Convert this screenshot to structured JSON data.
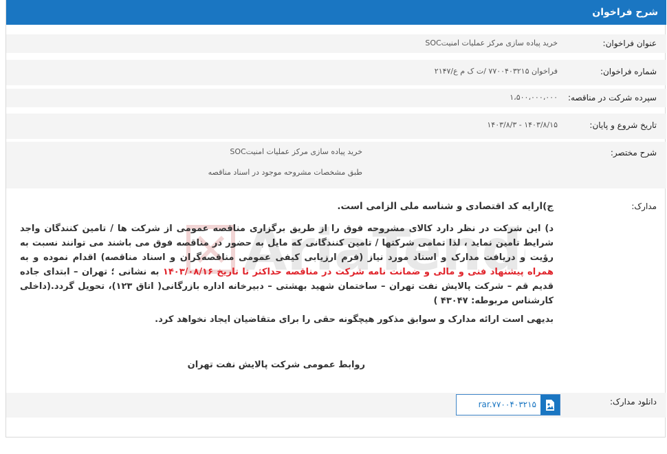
{
  "header": {
    "title": "شرح فراخوان"
  },
  "rows": {
    "title": {
      "label": "عنوان فراخوان:",
      "value": "خرید پیاده سازی مرکز عملیات امنیتSOC"
    },
    "number": {
      "label": "شماره فراخوان:",
      "value": "فراخوان ۷۷۰۰۴۰۳۲۱۵ /ت ک م ع/۲۱۴۷"
    },
    "deposit": {
      "label": "سپرده شرکت در مناقصه:",
      "value": "۱،۵۰۰،۰۰۰،۰۰۰"
    },
    "dates": {
      "label": "تاریخ شروع و پایان:",
      "value": "۱۴۰۳/۸/۱۵ - ۱۴۰۳/۸/۳"
    },
    "summary": {
      "label": "شرح مختصر:",
      "line1": "خرید پیاده سازی مرکز عملیات امنیتSOC",
      "line2": "طبق مشخصات مشروحه موجود در اسناد مناقصه"
    },
    "documents": {
      "label": "مدارک:"
    },
    "download": {
      "label": "دانلود مدارک:",
      "file": "rar.۷۷۰۰۴۰۳۲۱۵"
    }
  },
  "body": {
    "para_c": "ج)ارایه کد اقتصادی و شناسه ملی الزامی است.",
    "para_d_1": "د) این شرکت در نظر دارد کالای مشروحه فوق را از طریق برگزاری مناقصه عمومی از شرکت ها / تامین کنندگان واجد شرایط تامین نماید ، لذا تمامی شرکتها / تامین کنندگانی که مایل به حضور در مناقصه فوق می باشند می توانند نسبت به رؤیت و دریافت مدارک و اسناد مورد نیاز (فرم ارزیابی کیفی عمومی مناقصه‌گران و اسناد مناقصه) اقدام نموده و به",
    "para_d_red": "همراه پیشنهاد فنی و مالی و ضمانت نامه شرکت در مناقصه حداکثر تا تاریخ  ۱۴۰۳/۰۸/۱۶",
    "para_d_2": " به نشانی ؛ تهران – ابتدای جاده قدیم قم – شرکت پالایش نفت تهران – ساختمان شهید بهشتی – دبیرخانه اداره بازرگانی( اتاق ۱۲۳)، تحویل گردد.(داخلی کارشناس مربوطه: ۴۳۰۴۷ )",
    "para_e": "بدیهی است ارائه مدارک و سوابق مذکور هیچگونه حقی را برای متقاضیان ایجاد نخواهد کرد.",
    "signature": "روابط عمومی شرکت پالایش نفت تهران"
  },
  "watermark": {
    "text": "AriaTender.neT"
  },
  "colors": {
    "accent": "#1a76c2",
    "highlight": "#e0242b"
  }
}
